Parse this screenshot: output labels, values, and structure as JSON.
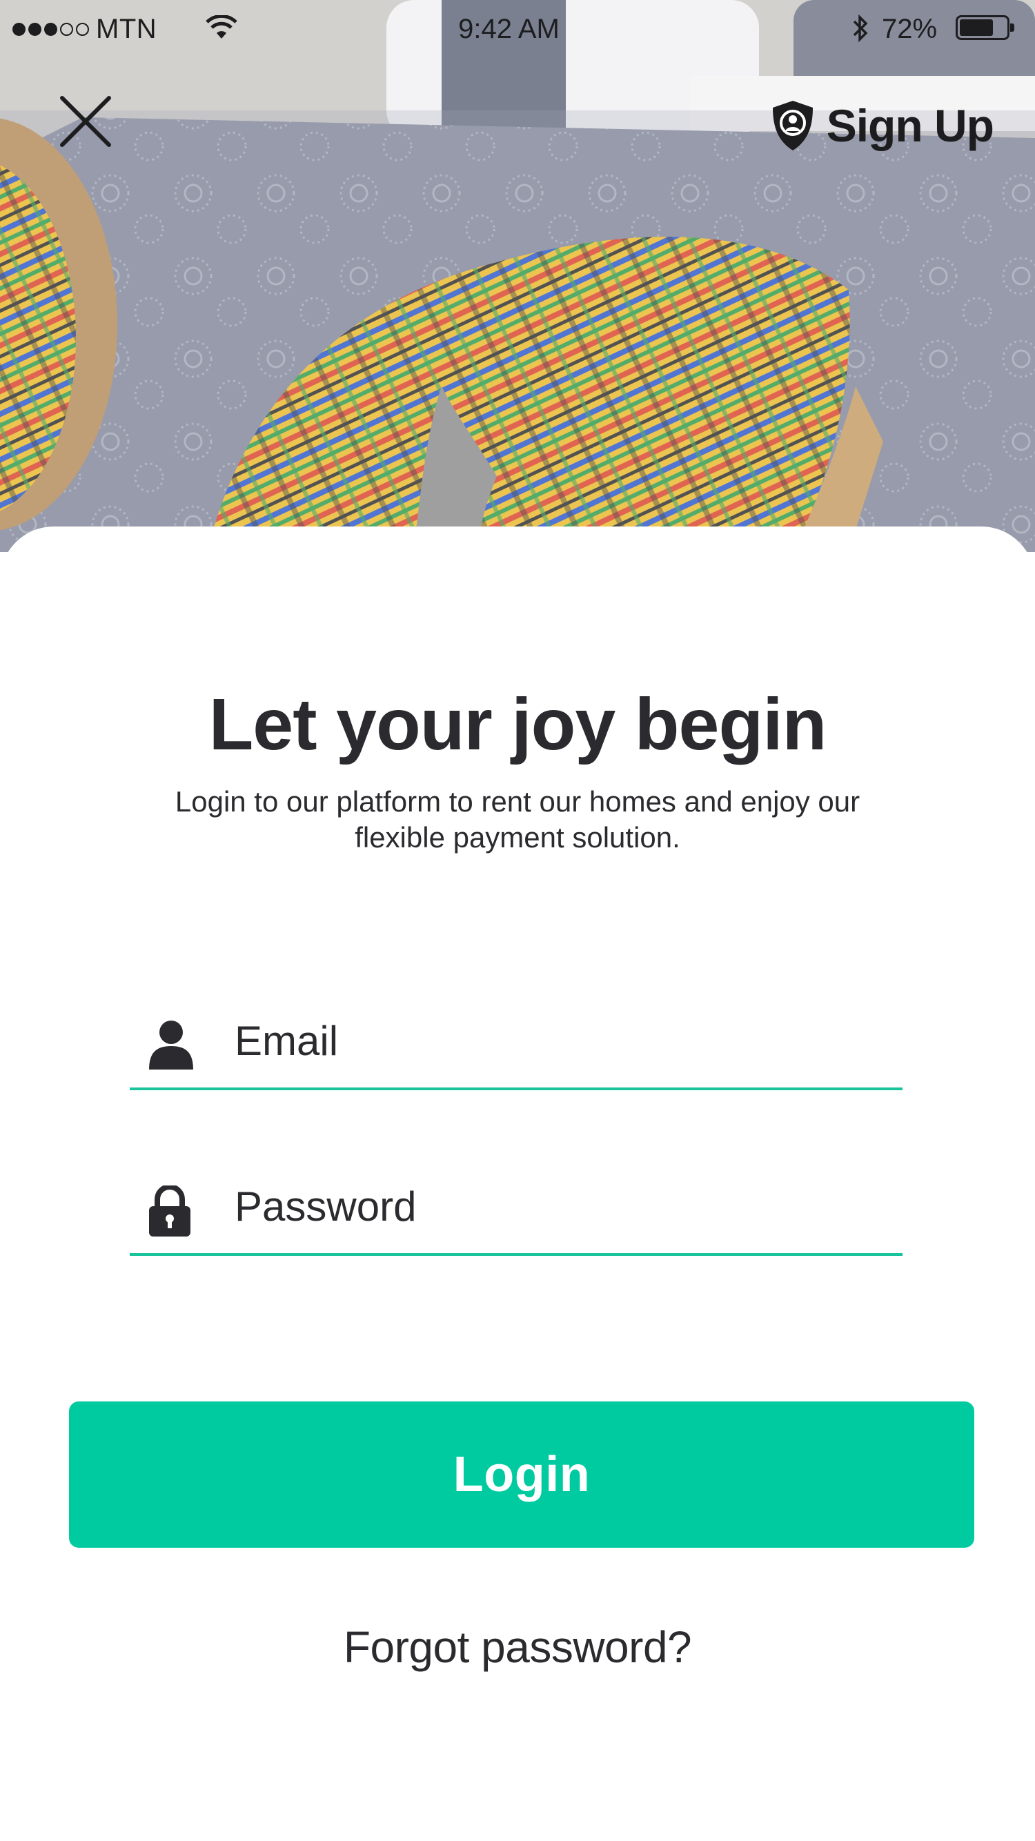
{
  "status_bar": {
    "carrier": "MTN",
    "time": "9:42 AM",
    "battery_percent": "72%",
    "battery_level": 0.72,
    "signal_bars_filled": 3,
    "signal_bars_total": 5
  },
  "nav": {
    "close_icon": "close-icon",
    "signup_icon": "shield-user-icon",
    "signup_label": "Sign Up"
  },
  "main": {
    "title": "Let your joy begin",
    "subtitle": "Login to our platform to rent our homes and enjoy our flexible payment solution."
  },
  "form": {
    "email": {
      "icon": "user-icon",
      "placeholder": "Email",
      "value": ""
    },
    "password": {
      "icon": "lock-icon",
      "placeholder": "Password",
      "value": ""
    },
    "login_label": "Login",
    "forgot_label": "Forgot password?"
  },
  "colors": {
    "accent": "#00cba0",
    "underline": "#19c39c",
    "text": "#2b2a2e",
    "background": "#ffffff"
  }
}
